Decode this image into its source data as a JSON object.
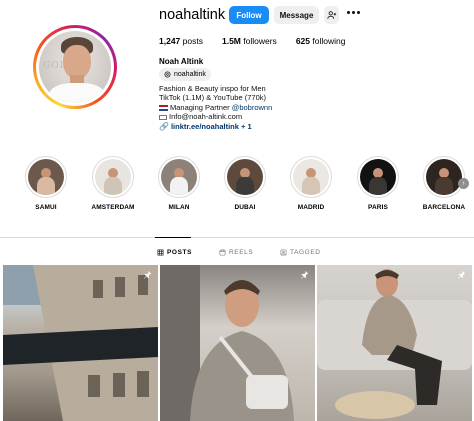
{
  "profile": {
    "username": "noahaltink",
    "verified_icon": "verified-badge-icon",
    "follow_label": "Follow",
    "message_label": "Message",
    "suggest_icon": "add-person-icon",
    "more_icon": "more-horizontal-icon",
    "avatar_alt_text": "Noah Altink profile photo",
    "stats": {
      "posts_count": "1,247",
      "posts_label": "posts",
      "followers_count": "1.5M",
      "followers_label": "followers",
      "following_count": "625",
      "following_label": "following"
    },
    "full_name": "Noah Altink",
    "threads_handle": "noahaltink",
    "bio": {
      "line1": "Fashion & Beauty inspo for Men",
      "line2": "TikTok (1.1M) & YouTube (770k)",
      "line3_prefix": "Managing Partner ",
      "line3_mention": "@bobrownn",
      "line4": "Info@noah-altink.com",
      "line5_link": "linktr.ee/noahaltink",
      "line5_more": " + 1"
    }
  },
  "highlights": [
    {
      "label": "SAMUI",
      "bg": "#6b5a4c",
      "body": "#d9b9a0"
    },
    {
      "label": "AMSTERDAM",
      "bg": "#e8e4df",
      "body": "#cfc4b8"
    },
    {
      "label": "MILAN",
      "bg": "#8c8279",
      "body": "#f2f2f2"
    },
    {
      "label": "DUBAI",
      "bg": "#5d4a3c",
      "body": "#3d3b3a"
    },
    {
      "label": "MADRID",
      "bg": "#ebe7e2",
      "body": "#d6c4b4"
    },
    {
      "label": "PARIS",
      "bg": "#121212",
      "body": "#3a3633"
    },
    {
      "label": "BARCELONA",
      "bg": "#2e2420",
      "body": "#4a3a30"
    }
  ],
  "tabs": [
    {
      "label": "POSTS",
      "icon": "grid-icon",
      "active": true
    },
    {
      "label": "REELS",
      "icon": "reels-icon",
      "active": false
    },
    {
      "label": "TAGGED",
      "icon": "tagged-icon",
      "active": false
    }
  ],
  "posts": [
    {
      "description": "Paris building facade",
      "pinned_icon": "pin-icon"
    },
    {
      "description": "Man in grey sweater with bag",
      "pinned_icon": "pin-icon"
    },
    {
      "description": "Man seated on sofa wearing loafers",
      "pinned_icon": "pin-icon"
    }
  ],
  "colors": {
    "follow_button": "#1a8cf5",
    "secondary_button": "#efefef",
    "link": "#00376b"
  }
}
